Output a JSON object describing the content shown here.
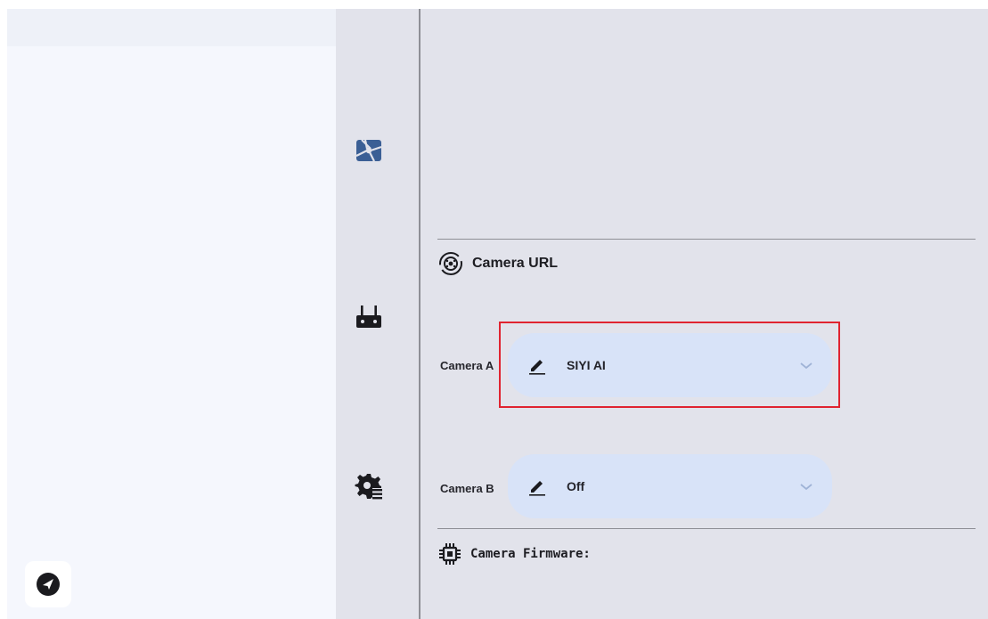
{
  "colors": {
    "accent_icon": "#3b5f95",
    "dropdown_bg": "#d8e3f8",
    "highlight": "#e02430"
  },
  "rail": {
    "icons": [
      "camera-icon",
      "remote-controller-icon",
      "settings-list-icon"
    ]
  },
  "camera_url": {
    "title": "Camera URL",
    "icon": "video-network-icon",
    "camera_a": {
      "label": "Camera A",
      "value": "SIYI AI"
    },
    "camera_b": {
      "label": "Camera B",
      "value": "Off"
    }
  },
  "camera_firmware": {
    "title": "Camera Firmware:",
    "icon": "chip-icon"
  },
  "fab": {
    "icon": "send-icon"
  }
}
